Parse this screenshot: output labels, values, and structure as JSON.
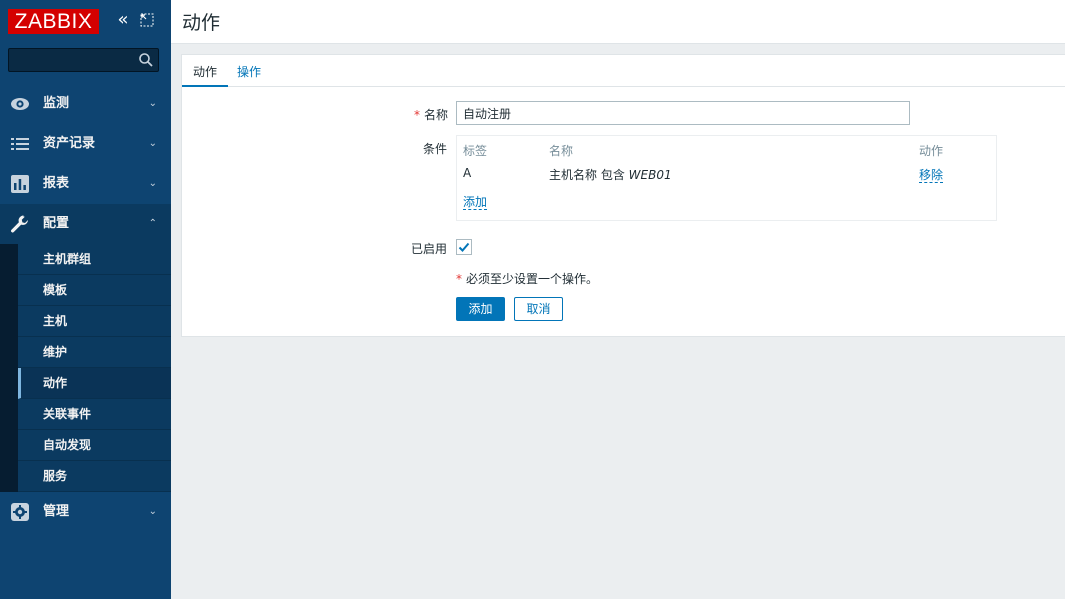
{
  "app": {
    "logo_text": "ZABBIX"
  },
  "sidebar": {
    "search": {
      "value": "",
      "placeholder": ""
    },
    "menu": [
      {
        "label": "监测",
        "icon": "eye-icon",
        "expanded": false
      },
      {
        "label": "资产记录",
        "icon": "list-icon",
        "expanded": false
      },
      {
        "label": "报表",
        "icon": "bar-chart-icon",
        "expanded": false
      },
      {
        "label": "配置",
        "icon": "wrench-icon",
        "expanded": true
      },
      {
        "label": "管理",
        "icon": "gear-icon",
        "expanded": false
      }
    ],
    "config_submenu": [
      {
        "label": "主机群组"
      },
      {
        "label": "模板"
      },
      {
        "label": "主机"
      },
      {
        "label": "维护"
      },
      {
        "label": "动作",
        "selected": true
      },
      {
        "label": "关联事件"
      },
      {
        "label": "自动发现"
      },
      {
        "label": "服务"
      }
    ]
  },
  "header": {
    "title": "动作"
  },
  "tabs": [
    {
      "label": "动作",
      "active": true
    },
    {
      "label": "操作",
      "active": false
    }
  ],
  "form": {
    "name_label": "名称",
    "name_value": "自动注册",
    "conditions_label": "条件",
    "conditions": {
      "columns": [
        "标签",
        "名称",
        "动作"
      ],
      "rows": [
        {
          "tag": "A",
          "name_prefix": "主机名称 包含 ",
          "name_value": "WEB01",
          "action": "移除"
        }
      ],
      "add_label": "添加"
    },
    "enabled_label": "已启用",
    "enabled": true,
    "required_note": "必须至少设置一个操作。",
    "submit_label": "添加",
    "cancel_label": "取消"
  },
  "colors": {
    "accent": "#0275b8",
    "sidebar": "#0e4471",
    "logo": "#d40000",
    "required": "#e33734"
  }
}
